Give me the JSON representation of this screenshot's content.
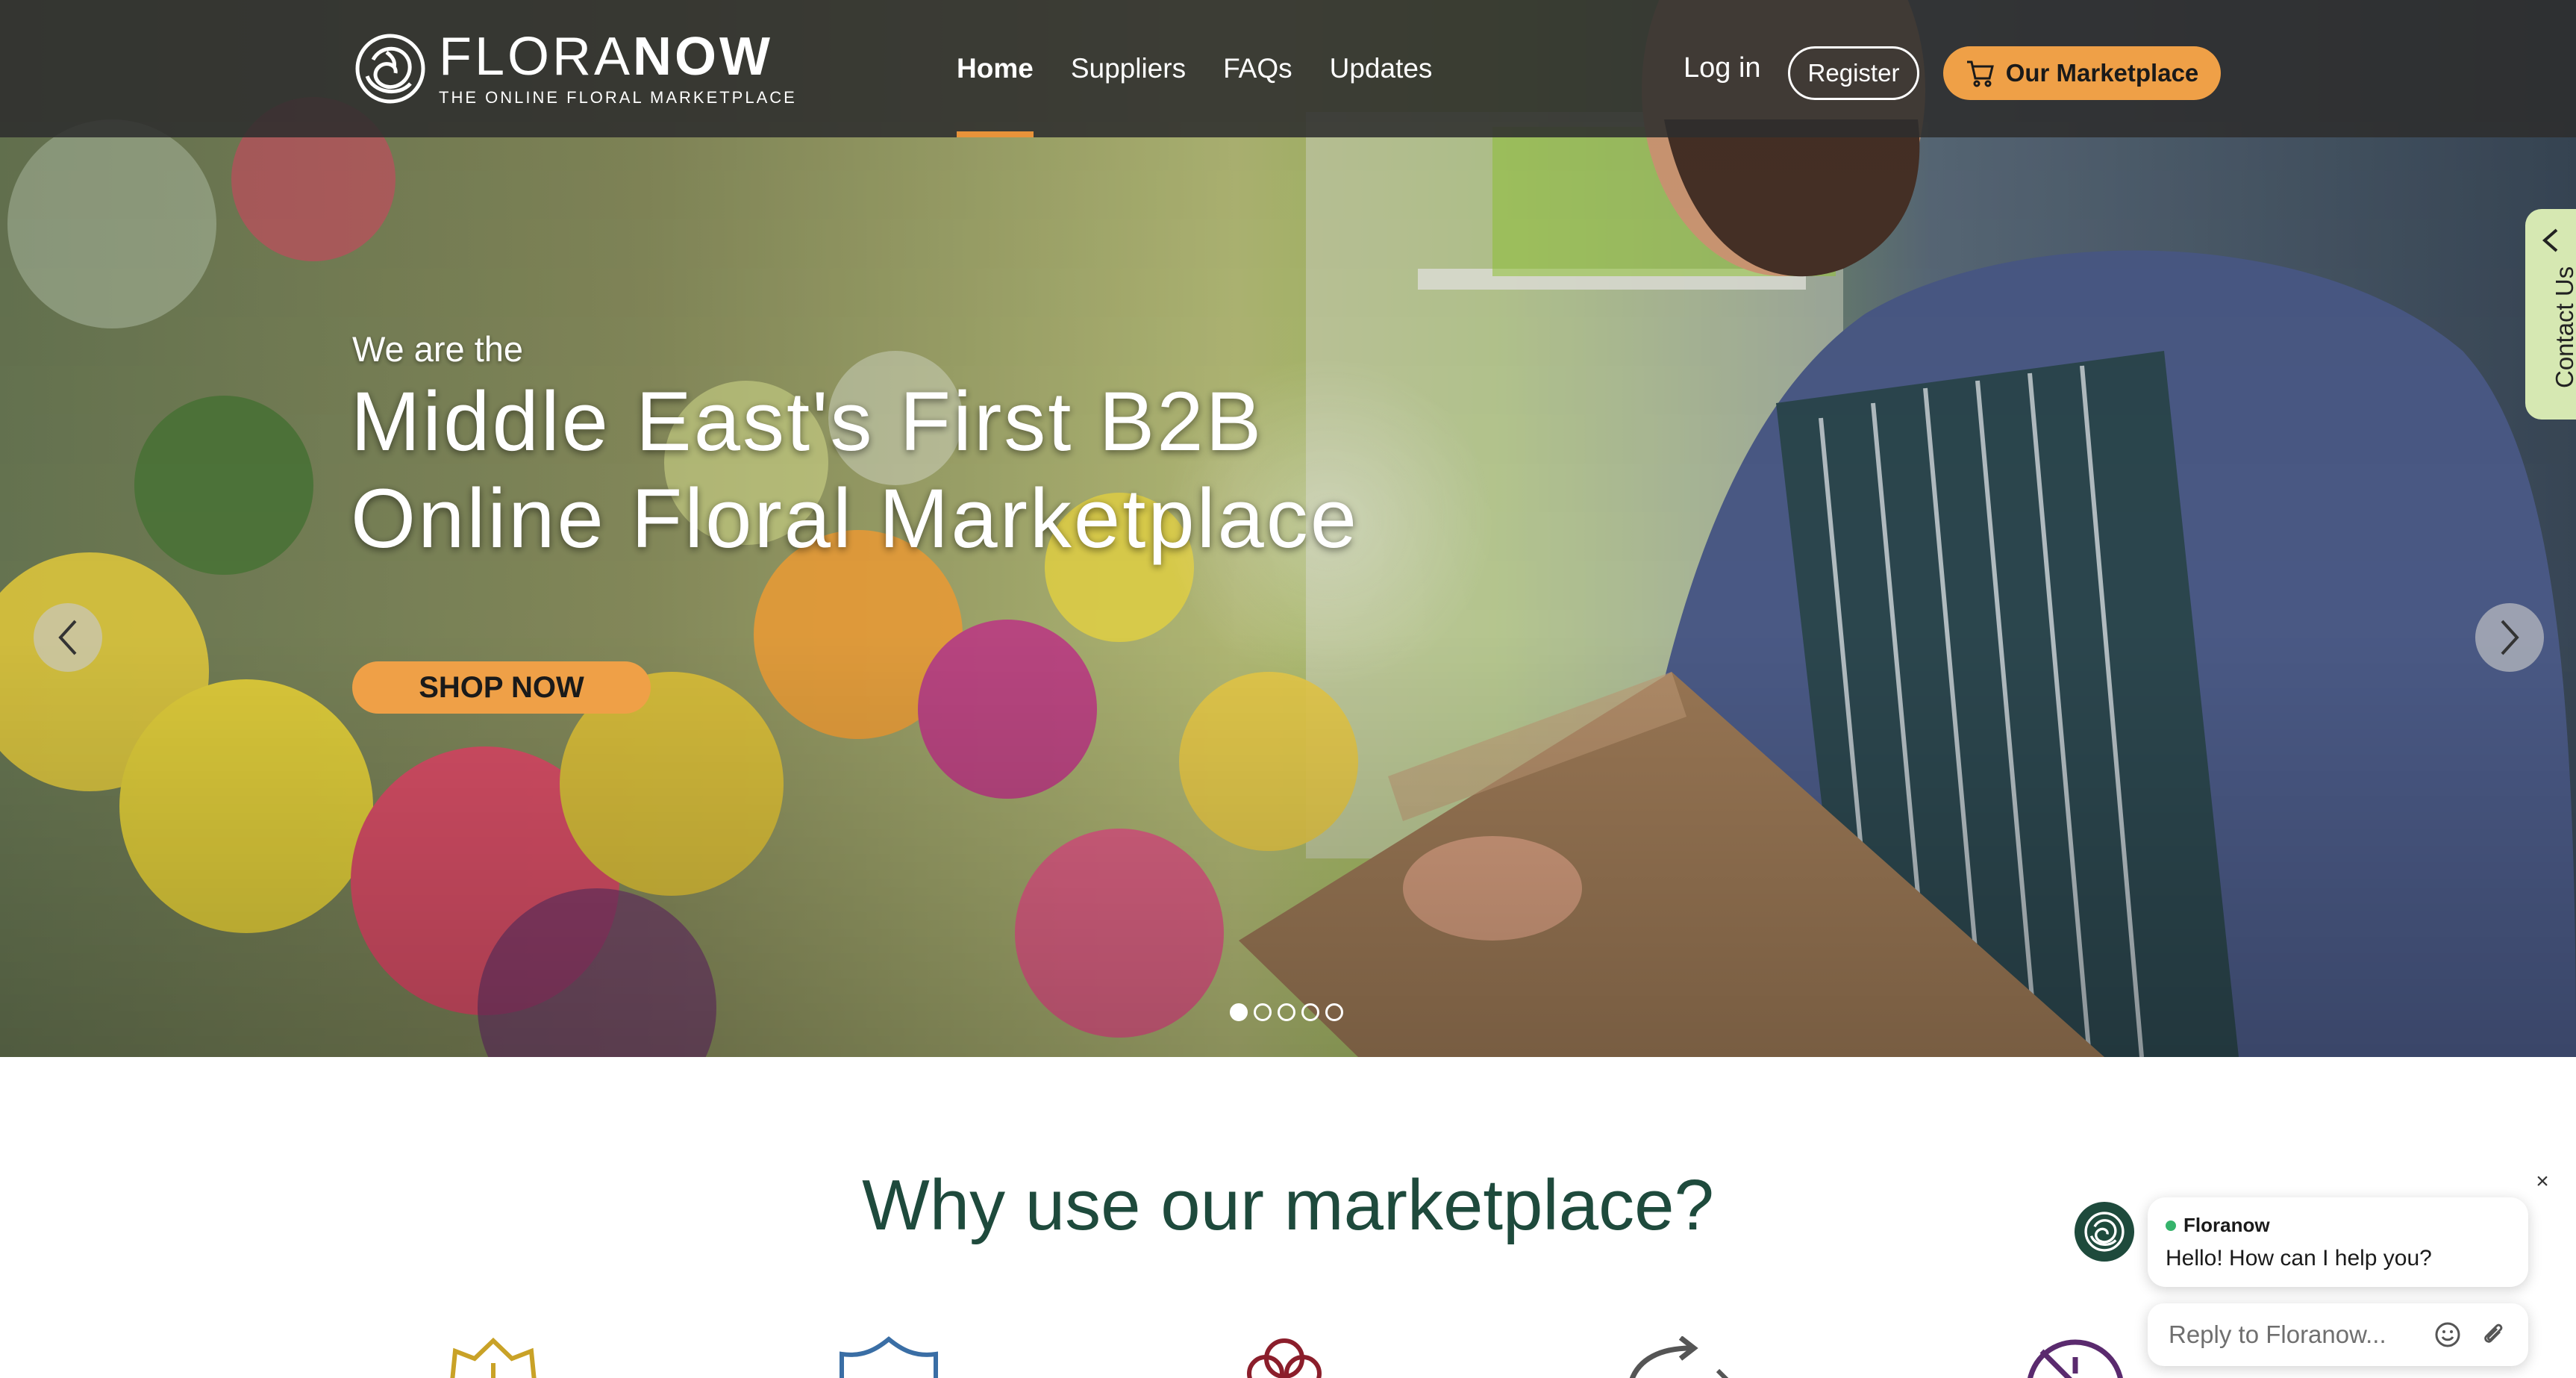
{
  "header": {
    "logo": {
      "word_thin": "FLORA",
      "word_bold": "NOW",
      "tagline": "THE ONLINE FLORAL MARKETPLACE"
    },
    "nav": [
      {
        "label": "Home",
        "active": true
      },
      {
        "label": "Suppliers",
        "active": false
      },
      {
        "label": "FAQs",
        "active": false
      },
      {
        "label": "Updates",
        "active": false
      }
    ],
    "login_label": "Log in",
    "register_label": "Register",
    "marketplace_label": "Our Marketplace",
    "accent_color": "#efa047"
  },
  "hero": {
    "pre_title": "We are the",
    "title_line1": "Middle East's First B2B",
    "title_line2": "Online Floral Marketplace",
    "cta_label": "SHOP NOW",
    "slides_total": 5,
    "active_slide": 1
  },
  "contact_tab": {
    "label": "Contact Us"
  },
  "why": {
    "title": "Why use our marketplace?",
    "title_color": "#1e4a3c",
    "icons": [
      {
        "name": "quality-badge-icon",
        "color": "#c9a227"
      },
      {
        "name": "shield-icon",
        "color": "#3a6ea5"
      },
      {
        "name": "flower-icon",
        "color": "#8b1e2b"
      },
      {
        "name": "share-arrow-icon",
        "color": "#555555"
      },
      {
        "name": "no-fee-icon",
        "color": "#5a2a6e"
      }
    ]
  },
  "chat": {
    "agent_name": "Floranow",
    "message": "Hello! How can I help you?",
    "input_placeholder": "Reply to Floranow...",
    "close_symbol": "×"
  }
}
